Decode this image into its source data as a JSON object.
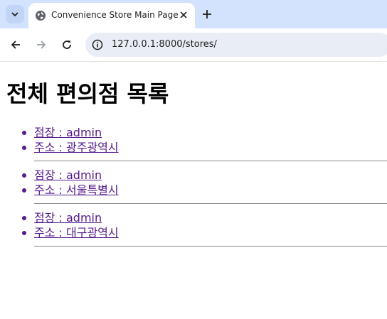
{
  "browser": {
    "tab": {
      "title": "Convenience Store Main Page"
    },
    "address_bar": {
      "url": "127.0.0.1:8000/stores/"
    }
  },
  "page": {
    "heading": "전체 편의점 목록",
    "stores": [
      {
        "manager": "점장 : admin",
        "address": "주소 : 광주광역시"
      },
      {
        "manager": "점장 : admin",
        "address": "주소 : 서울특별시"
      },
      {
        "manager": "점장 : admin",
        "address": "주소 : 대구광역시"
      }
    ]
  },
  "colors": {
    "tabstrip": "#d3e3fd",
    "omnibox": "#e9eef6",
    "visited_link": "#551a8b",
    "separator": "#8a8a8a"
  },
  "icons": {
    "tab_search": "chevron-down-icon",
    "favicon": "globe-icon",
    "tab_close": "close-icon",
    "new_tab": "plus-icon",
    "back": "arrow-left-icon",
    "forward": "arrow-right-icon",
    "reload": "reload-icon",
    "site_info": "info-icon"
  }
}
